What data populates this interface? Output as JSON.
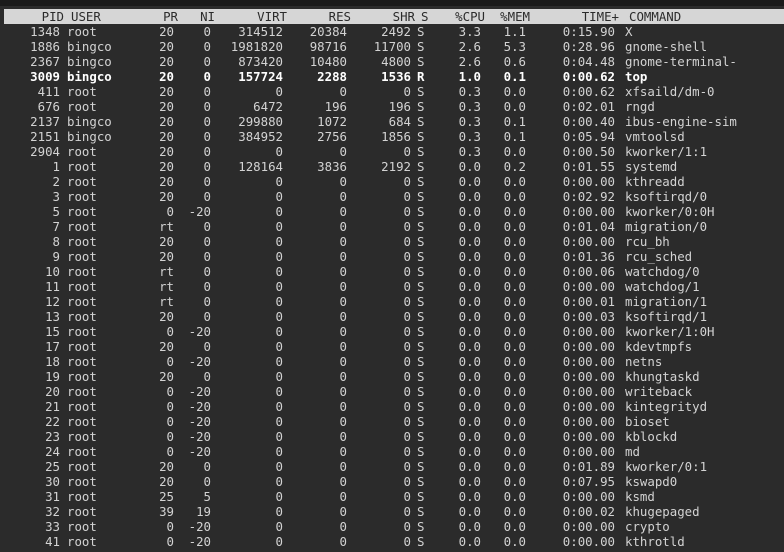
{
  "header": {
    "pid": "PID",
    "user": "USER",
    "pr": "PR",
    "ni": "NI",
    "virt": "VIRT",
    "res": "RES",
    "shr": "SHR",
    "s": "S",
    "cpu": "%CPU",
    "mem": "%MEM",
    "time": "TIME+",
    "cmd": "COMMAND"
  },
  "processes": [
    {
      "pid": "1348",
      "user": "root",
      "pr": "20",
      "ni": "0",
      "virt": "314512",
      "res": "20384",
      "shr": "2492",
      "s": "S",
      "cpu": "3.3",
      "mem": "1.1",
      "time": "0:15.90",
      "cmd": "X"
    },
    {
      "pid": "1886",
      "user": "bingco",
      "pr": "20",
      "ni": "0",
      "virt": "1981820",
      "res": "98716",
      "shr": "11700",
      "s": "S",
      "cpu": "2.6",
      "mem": "5.3",
      "time": "0:28.96",
      "cmd": "gnome-shell"
    },
    {
      "pid": "2367",
      "user": "bingco",
      "pr": "20",
      "ni": "0",
      "virt": "873420",
      "res": "10480",
      "shr": "4800",
      "s": "S",
      "cpu": "2.6",
      "mem": "0.6",
      "time": "0:04.48",
      "cmd": "gnome-terminal-"
    },
    {
      "pid": "3009",
      "user": "bingco",
      "pr": "20",
      "ni": "0",
      "virt": "157724",
      "res": "2288",
      "shr": "1536",
      "s": "R",
      "cpu": "1.0",
      "mem": "0.1",
      "time": "0:00.62",
      "cmd": "top"
    },
    {
      "pid": "411",
      "user": "root",
      "pr": "20",
      "ni": "0",
      "virt": "0",
      "res": "0",
      "shr": "0",
      "s": "S",
      "cpu": "0.3",
      "mem": "0.0",
      "time": "0:00.62",
      "cmd": "xfsaild/dm-0"
    },
    {
      "pid": "676",
      "user": "root",
      "pr": "20",
      "ni": "0",
      "virt": "6472",
      "res": "196",
      "shr": "196",
      "s": "S",
      "cpu": "0.3",
      "mem": "0.0",
      "time": "0:02.01",
      "cmd": "rngd"
    },
    {
      "pid": "2137",
      "user": "bingco",
      "pr": "20",
      "ni": "0",
      "virt": "299880",
      "res": "1072",
      "shr": "684",
      "s": "S",
      "cpu": "0.3",
      "mem": "0.1",
      "time": "0:00.40",
      "cmd": "ibus-engine-sim"
    },
    {
      "pid": "2151",
      "user": "bingco",
      "pr": "20",
      "ni": "0",
      "virt": "384952",
      "res": "2756",
      "shr": "1856",
      "s": "S",
      "cpu": "0.3",
      "mem": "0.1",
      "time": "0:05.94",
      "cmd": "vmtoolsd"
    },
    {
      "pid": "2904",
      "user": "root",
      "pr": "20",
      "ni": "0",
      "virt": "0",
      "res": "0",
      "shr": "0",
      "s": "S",
      "cpu": "0.3",
      "mem": "0.0",
      "time": "0:00.50",
      "cmd": "kworker/1:1"
    },
    {
      "pid": "1",
      "user": "root",
      "pr": "20",
      "ni": "0",
      "virt": "128164",
      "res": "3836",
      "shr": "2192",
      "s": "S",
      "cpu": "0.0",
      "mem": "0.2",
      "time": "0:01.55",
      "cmd": "systemd"
    },
    {
      "pid": "2",
      "user": "root",
      "pr": "20",
      "ni": "0",
      "virt": "0",
      "res": "0",
      "shr": "0",
      "s": "S",
      "cpu": "0.0",
      "mem": "0.0",
      "time": "0:00.00",
      "cmd": "kthreadd"
    },
    {
      "pid": "3",
      "user": "root",
      "pr": "20",
      "ni": "0",
      "virt": "0",
      "res": "0",
      "shr": "0",
      "s": "S",
      "cpu": "0.0",
      "mem": "0.0",
      "time": "0:02.92",
      "cmd": "ksoftirqd/0"
    },
    {
      "pid": "5",
      "user": "root",
      "pr": "0",
      "ni": "-20",
      "virt": "0",
      "res": "0",
      "shr": "0",
      "s": "S",
      "cpu": "0.0",
      "mem": "0.0",
      "time": "0:00.00",
      "cmd": "kworker/0:0H"
    },
    {
      "pid": "7",
      "user": "root",
      "pr": "rt",
      "ni": "0",
      "virt": "0",
      "res": "0",
      "shr": "0",
      "s": "S",
      "cpu": "0.0",
      "mem": "0.0",
      "time": "0:01.04",
      "cmd": "migration/0"
    },
    {
      "pid": "8",
      "user": "root",
      "pr": "20",
      "ni": "0",
      "virt": "0",
      "res": "0",
      "shr": "0",
      "s": "S",
      "cpu": "0.0",
      "mem": "0.0",
      "time": "0:00.00",
      "cmd": "rcu_bh"
    },
    {
      "pid": "9",
      "user": "root",
      "pr": "20",
      "ni": "0",
      "virt": "0",
      "res": "0",
      "shr": "0",
      "s": "S",
      "cpu": "0.0",
      "mem": "0.0",
      "time": "0:01.36",
      "cmd": "rcu_sched"
    },
    {
      "pid": "10",
      "user": "root",
      "pr": "rt",
      "ni": "0",
      "virt": "0",
      "res": "0",
      "shr": "0",
      "s": "S",
      "cpu": "0.0",
      "mem": "0.0",
      "time": "0:00.06",
      "cmd": "watchdog/0"
    },
    {
      "pid": "11",
      "user": "root",
      "pr": "rt",
      "ni": "0",
      "virt": "0",
      "res": "0",
      "shr": "0",
      "s": "S",
      "cpu": "0.0",
      "mem": "0.0",
      "time": "0:00.00",
      "cmd": "watchdog/1"
    },
    {
      "pid": "12",
      "user": "root",
      "pr": "rt",
      "ni": "0",
      "virt": "0",
      "res": "0",
      "shr": "0",
      "s": "S",
      "cpu": "0.0",
      "mem": "0.0",
      "time": "0:00.01",
      "cmd": "migration/1"
    },
    {
      "pid": "13",
      "user": "root",
      "pr": "20",
      "ni": "0",
      "virt": "0",
      "res": "0",
      "shr": "0",
      "s": "S",
      "cpu": "0.0",
      "mem": "0.0",
      "time": "0:00.03",
      "cmd": "ksoftirqd/1"
    },
    {
      "pid": "15",
      "user": "root",
      "pr": "0",
      "ni": "-20",
      "virt": "0",
      "res": "0",
      "shr": "0",
      "s": "S",
      "cpu": "0.0",
      "mem": "0.0",
      "time": "0:00.00",
      "cmd": "kworker/1:0H"
    },
    {
      "pid": "17",
      "user": "root",
      "pr": "20",
      "ni": "0",
      "virt": "0",
      "res": "0",
      "shr": "0",
      "s": "S",
      "cpu": "0.0",
      "mem": "0.0",
      "time": "0:00.00",
      "cmd": "kdevtmpfs"
    },
    {
      "pid": "18",
      "user": "root",
      "pr": "0",
      "ni": "-20",
      "virt": "0",
      "res": "0",
      "shr": "0",
      "s": "S",
      "cpu": "0.0",
      "mem": "0.0",
      "time": "0:00.00",
      "cmd": "netns"
    },
    {
      "pid": "19",
      "user": "root",
      "pr": "20",
      "ni": "0",
      "virt": "0",
      "res": "0",
      "shr": "0",
      "s": "S",
      "cpu": "0.0",
      "mem": "0.0",
      "time": "0:00.00",
      "cmd": "khungtaskd"
    },
    {
      "pid": "20",
      "user": "root",
      "pr": "0",
      "ni": "-20",
      "virt": "0",
      "res": "0",
      "shr": "0",
      "s": "S",
      "cpu": "0.0",
      "mem": "0.0",
      "time": "0:00.00",
      "cmd": "writeback"
    },
    {
      "pid": "21",
      "user": "root",
      "pr": "0",
      "ni": "-20",
      "virt": "0",
      "res": "0",
      "shr": "0",
      "s": "S",
      "cpu": "0.0",
      "mem": "0.0",
      "time": "0:00.00",
      "cmd": "kintegrityd"
    },
    {
      "pid": "22",
      "user": "root",
      "pr": "0",
      "ni": "-20",
      "virt": "0",
      "res": "0",
      "shr": "0",
      "s": "S",
      "cpu": "0.0",
      "mem": "0.0",
      "time": "0:00.00",
      "cmd": "bioset"
    },
    {
      "pid": "23",
      "user": "root",
      "pr": "0",
      "ni": "-20",
      "virt": "0",
      "res": "0",
      "shr": "0",
      "s": "S",
      "cpu": "0.0",
      "mem": "0.0",
      "time": "0:00.00",
      "cmd": "kblockd"
    },
    {
      "pid": "24",
      "user": "root",
      "pr": "0",
      "ni": "-20",
      "virt": "0",
      "res": "0",
      "shr": "0",
      "s": "S",
      "cpu": "0.0",
      "mem": "0.0",
      "time": "0:00.00",
      "cmd": "md"
    },
    {
      "pid": "25",
      "user": "root",
      "pr": "20",
      "ni": "0",
      "virt": "0",
      "res": "0",
      "shr": "0",
      "s": "S",
      "cpu": "0.0",
      "mem": "0.0",
      "time": "0:01.89",
      "cmd": "kworker/0:1"
    },
    {
      "pid": "30",
      "user": "root",
      "pr": "20",
      "ni": "0",
      "virt": "0",
      "res": "0",
      "shr": "0",
      "s": "S",
      "cpu": "0.0",
      "mem": "0.0",
      "time": "0:07.95",
      "cmd": "kswapd0"
    },
    {
      "pid": "31",
      "user": "root",
      "pr": "25",
      "ni": "5",
      "virt": "0",
      "res": "0",
      "shr": "0",
      "s": "S",
      "cpu": "0.0",
      "mem": "0.0",
      "time": "0:00.00",
      "cmd": "ksmd"
    },
    {
      "pid": "32",
      "user": "root",
      "pr": "39",
      "ni": "19",
      "virt": "0",
      "res": "0",
      "shr": "0",
      "s": "S",
      "cpu": "0.0",
      "mem": "0.0",
      "time": "0:00.02",
      "cmd": "khugepaged"
    },
    {
      "pid": "33",
      "user": "root",
      "pr": "0",
      "ni": "-20",
      "virt": "0",
      "res": "0",
      "shr": "0",
      "s": "S",
      "cpu": "0.0",
      "mem": "0.0",
      "time": "0:00.00",
      "cmd": "crypto"
    },
    {
      "pid": "41",
      "user": "root",
      "pr": "0",
      "ni": "-20",
      "virt": "0",
      "res": "0",
      "shr": "0",
      "s": "S",
      "cpu": "0.0",
      "mem": "0.0",
      "time": "0:00.00",
      "cmd": "kthrotld"
    }
  ],
  "colors": {
    "background": "#2b2b2b",
    "foreground": "#d3d3d3",
    "header_bg": "#d6d6d6",
    "highlight": "#ffffff"
  }
}
